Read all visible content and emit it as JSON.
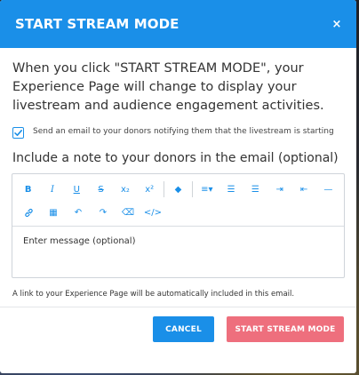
{
  "modal": {
    "title": "START STREAM MODE",
    "close_icon": "×",
    "intro_text": "When you click \"START STREAM MODE\", your Experience Page will change to display your livestream and audience engagement activities.",
    "email_checkbox": {
      "checked": true,
      "label": "Send an email to your donors notifying them that the livestream is starting"
    },
    "note_label": "Include a note to your donors in the email (optional)",
    "editor": {
      "placeholder": "Enter message (optional)",
      "toolbar_row1": [
        {
          "name": "bold-icon",
          "glyph": "B"
        },
        {
          "name": "italic-icon",
          "glyph": "I"
        },
        {
          "name": "underline-icon",
          "glyph": "U"
        },
        {
          "name": "strikethrough-icon",
          "glyph": "S"
        },
        {
          "name": "subscript-icon",
          "glyph": "x₂"
        },
        {
          "name": "superscript-icon",
          "glyph": "x²"
        },
        {
          "name": "text-color-icon",
          "glyph": "◆"
        },
        {
          "name": "align-icon",
          "glyph": "≡▾"
        },
        {
          "name": "ordered-list-icon",
          "glyph": "☰"
        },
        {
          "name": "unordered-list-icon",
          "glyph": "☰"
        },
        {
          "name": "indent-icon",
          "glyph": "⇥"
        },
        {
          "name": "outdent-icon",
          "glyph": "⇤"
        },
        {
          "name": "horizontal-rule-icon",
          "glyph": "—"
        }
      ],
      "toolbar_row2": [
        {
          "name": "link-icon",
          "glyph": "🔗"
        },
        {
          "name": "table-icon",
          "glyph": "▦"
        },
        {
          "name": "undo-icon",
          "glyph": "↶"
        },
        {
          "name": "redo-icon",
          "glyph": "↷"
        },
        {
          "name": "clear-format-icon",
          "glyph": "⌫"
        },
        {
          "name": "code-view-icon",
          "glyph": "</>"
        }
      ]
    },
    "hint_text": "A link to your Experience Page will be automatically included in this email.",
    "cancel_label": "CANCEL",
    "start_label": "START STREAM MODE"
  },
  "colors": {
    "primary": "#1a8fe8",
    "start_button": "#ee6f7d"
  }
}
